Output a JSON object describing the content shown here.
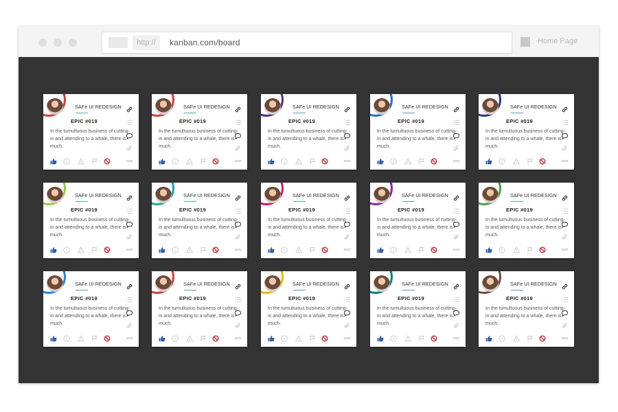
{
  "browser": {
    "protocol": "http://",
    "url": "kanban.com/board",
    "home_label": "Home Page"
  },
  "card_template": {
    "title": "SAFe UI REDESIGN",
    "epic": "EPIC #019",
    "description": "In the tumultuous business of cutting-in and attending to a whale, there is much."
  },
  "colors": {
    "content_bg": "#333333",
    "like_icon": "#2f5fb3",
    "stop_icon": "#e0242e",
    "underline": "#4aa8e0"
  },
  "cards": [
    {
      "ring_color": "#e53935"
    },
    {
      "ring_color": "#e53935"
    },
    {
      "ring_color": "#5b2a86"
    },
    {
      "ring_color": "#1e6fd9"
    },
    {
      "ring_color": "#283593"
    },
    {
      "ring_color": "#9acd32"
    },
    {
      "ring_color": "#1aa7b0"
    },
    {
      "ring_color": "#d81b60"
    },
    {
      "ring_color": "#8e24aa"
    },
    {
      "ring_color": "#43a047"
    },
    {
      "ring_color": "#1e88e5"
    },
    {
      "ring_color": "#e53935"
    },
    {
      "ring_color": "#f9b800"
    },
    {
      "ring_color": "#00897b"
    },
    {
      "ring_color": "#6d4c41"
    }
  ]
}
